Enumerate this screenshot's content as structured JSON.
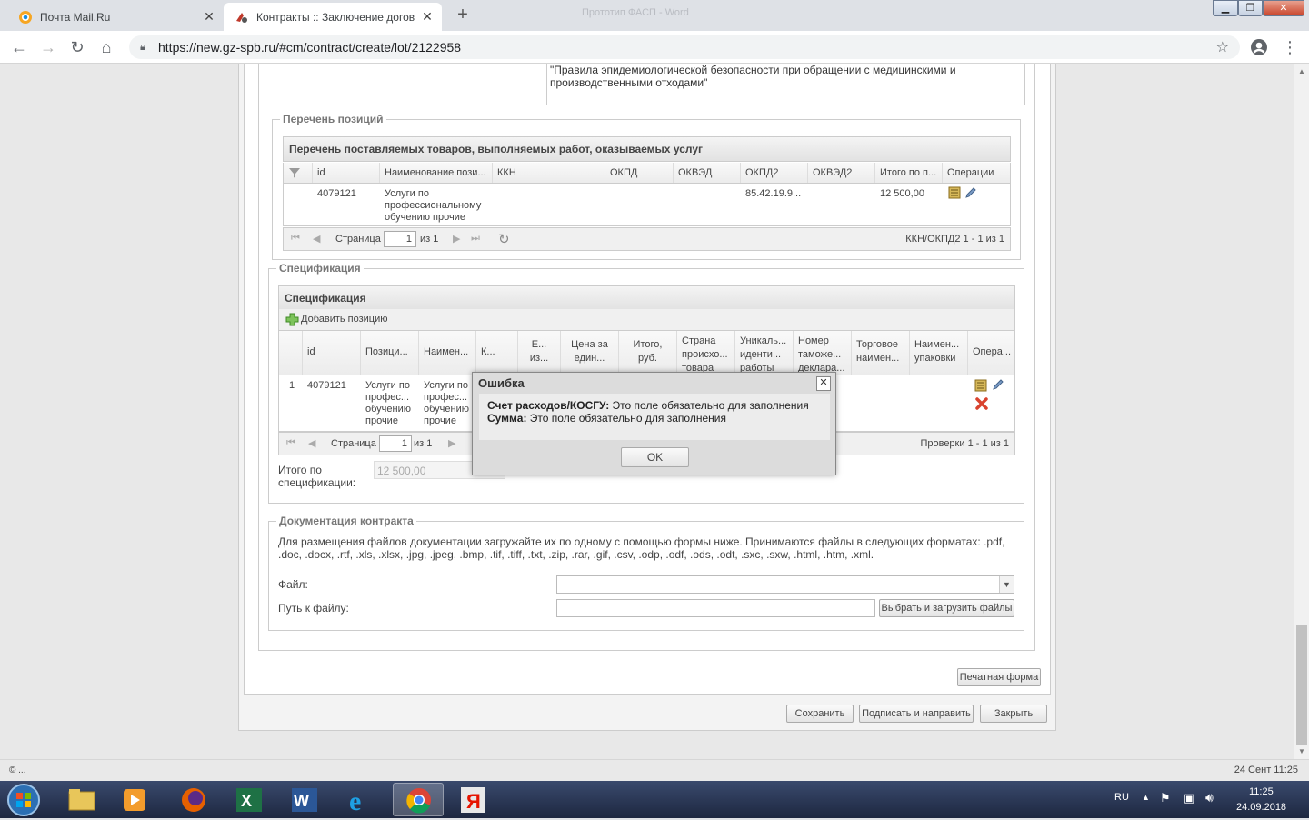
{
  "browser": {
    "tabs": [
      {
        "title": "Почта Mail.Ru",
        "active": false,
        "icon": "mailru-icon"
      },
      {
        "title": "Контракты :: Заключение догов",
        "active": true,
        "icon": "gz-spb-icon"
      }
    ],
    "url": "https://new.gz-spb.ru/#cm/contract/create/lot/2122958",
    "window_title_ghost": "Прототип ФАСП - Word"
  },
  "top_text": "\"Правила эпидемиологической безопасности при обращении с медицинскими и производственными отходами\"",
  "positions": {
    "legend": "Перечень позиций",
    "grid_title": "Перечень поставляемых товаров, выполняемых работ, оказываемых услуг",
    "columns": [
      "id",
      "Наименование пози...",
      "ККН",
      "ОКПД",
      "ОКВЭД",
      "ОКПД2",
      "ОКВЭД2",
      "Итого по п...",
      "Операции"
    ],
    "rows": [
      {
        "id": "4079121",
        "name": "Услуги по профессиональному обучению прочие",
        "kkn": "",
        "okpd": "",
        "okved": "",
        "okpd2": "85.42.19.9...",
        "okved2": "",
        "total": "12 500,00"
      }
    ],
    "pager": {
      "page_label": "Страница",
      "page": "1",
      "of": "из 1",
      "summary": "ККН/ОКПД2 1 - 1 из 1"
    }
  },
  "spec": {
    "legend": "Спецификация",
    "grid_title": "Спецификация",
    "add_label": "Добавить позицию",
    "columns": [
      "id",
      "Позици...",
      "Наимен...",
      "К...",
      "Е... из...",
      "Цена за един...",
      "Итого, руб.",
      "Страна происхо... товара",
      "Уникаль... иденти... работы",
      "Номер таможе... деклара...",
      "Торговое наимен...",
      "Наимен... упаковки",
      "Опера..."
    ],
    "rows": [
      {
        "num": "1",
        "id": "4079121",
        "position": "Услуги по профес... обучению прочие",
        "name": "Услуги по профес... обучению прочие"
      }
    ],
    "pager": {
      "page_label": "Страница",
      "page": "1",
      "of": "из 1",
      "summary": "Проверки 1 - 1 из 1"
    },
    "total_label": "Итого по спецификации:",
    "total_value": "12 500,00"
  },
  "docs": {
    "legend": "Документация контракта",
    "description": "Для размещения файлов документации загружайте их по одному с помощью формы ниже. Принимаются файлы в следующих форматах: .pdf, .doc, .docx, .rtf, .xls, .xlsx, .jpg, .jpeg, .bmp, .tif, .tiff, .txt, .zip, .rar, .gif, .csv, .odp, .odf, .ods, .odt, .sxc, .sxw, .html, .htm, .xml.",
    "file_label": "Файл:",
    "path_label": "Путь к файлу:",
    "upload_button": "Выбрать и загрузить файлы"
  },
  "buttons": {
    "print": "Печатная форма",
    "save": "Сохранить",
    "sign_send": "Подписать и направить",
    "close": "Закрыть"
  },
  "dialog": {
    "title": "Ошибка",
    "line1_bold": "Счет расходов/КОСГУ:",
    "line1_text": " Это поле обязательно для заполнения",
    "line2_bold": "Сумма:",
    "line2_text": " Это поле обязательно для заполнения",
    "ok": "OK"
  },
  "statusbar": {
    "left": "© ...",
    "right": "24 Сент 11:25"
  },
  "taskbar": {
    "lang": "RU",
    "time": "11:25",
    "date": "24.09.2018",
    "apps": [
      "start-orb-icon",
      "explorer-icon",
      "media-player-icon",
      "firefox-icon",
      "excel-icon",
      "word-icon",
      "ie-icon",
      "chrome-icon",
      "yandex-icon"
    ]
  }
}
